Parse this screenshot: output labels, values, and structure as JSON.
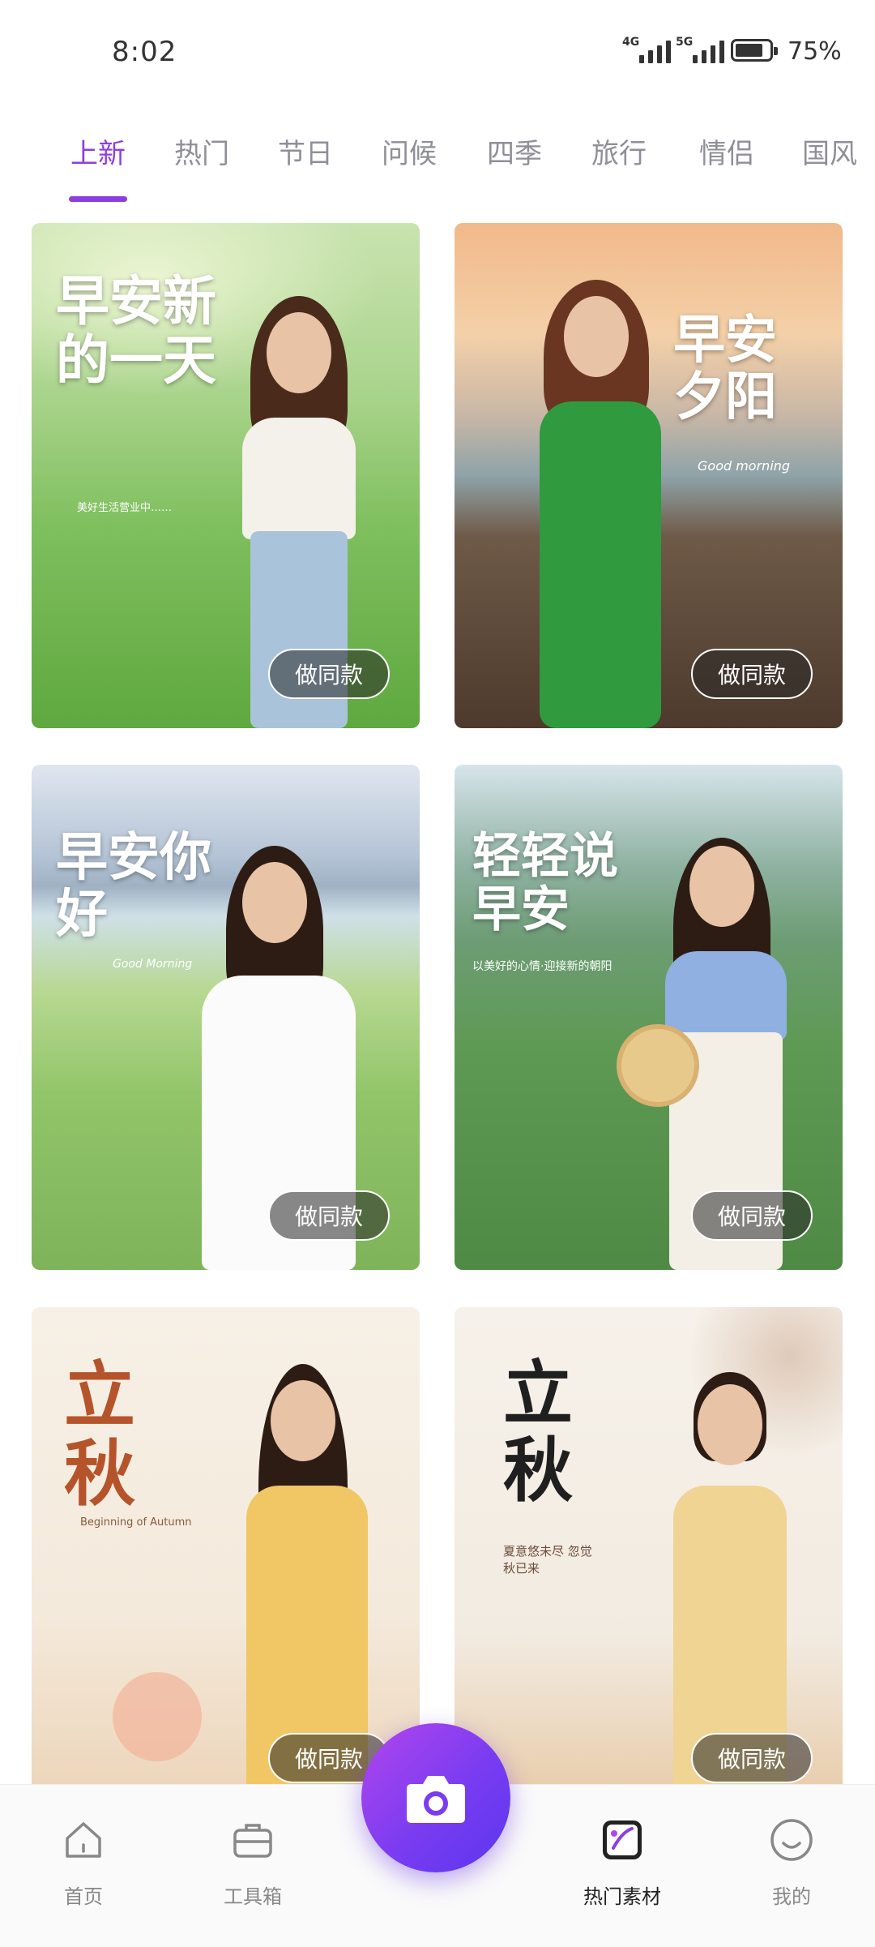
{
  "status_bar": {
    "time": "8:02",
    "signal1": "4G",
    "signal2": "5G",
    "battery": "75%"
  },
  "tabs": [
    "上新",
    "热门",
    "节日",
    "问候",
    "四季",
    "旅行",
    "情侣",
    "国风"
  ],
  "active_tab": "上新",
  "cards": [
    {
      "title": "早安新的一天",
      "subtitle": "美好生活营业中……",
      "button": "做同款"
    },
    {
      "title": "早安夕阳",
      "subtitle": "Good morning",
      "button": "做同款"
    },
    {
      "title": "早安你好",
      "subtitle": "Good Morning",
      "button": "做同款"
    },
    {
      "title": "轻轻说早安",
      "subtitle": "以美好的心情·迎接新的朝阳",
      "button": "做同款"
    },
    {
      "title": "立秋",
      "subtitle": "Beginning of Autumn",
      "button": "做同款"
    },
    {
      "title": "立秋",
      "subtitle": "夏意悠未尽 忽觉秋已来",
      "button": "做同款"
    }
  ],
  "bottom_nav": {
    "items": [
      {
        "label": "首页",
        "icon": "home-icon"
      },
      {
        "label": "工具箱",
        "icon": "toolbox-icon"
      },
      {
        "label": "热门素材",
        "icon": "hot-materials-icon"
      },
      {
        "label": "我的",
        "icon": "profile-icon"
      }
    ],
    "active": "热门素材",
    "camera_icon": "camera-icon"
  },
  "colors": {
    "accent": "#8b3fe0",
    "camera_gradient_start": "#b146ee",
    "camera_gradient_end": "#5a36f0"
  }
}
